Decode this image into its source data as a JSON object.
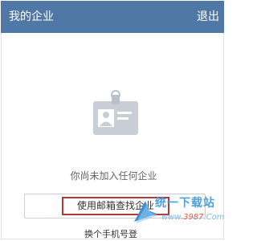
{
  "header": {
    "title": "我的企业",
    "action_label": "退出"
  },
  "empty_state": {
    "icon": "id-badge-icon",
    "message": "你尚未加入任何企业"
  },
  "primary_action": {
    "label": "使用邮箱查找企业"
  },
  "secondary_link": {
    "label": "换个手机号登"
  },
  "watermark": {
    "brand": "统一下载站",
    "url_prefix": "www.",
    "url_number": "3987",
    "url_suffix": ".Com"
  },
  "colors": {
    "header_bg": "#4f78a6",
    "highlight_border": "#b03a3a",
    "icon_gray": "#c5cbd3"
  }
}
